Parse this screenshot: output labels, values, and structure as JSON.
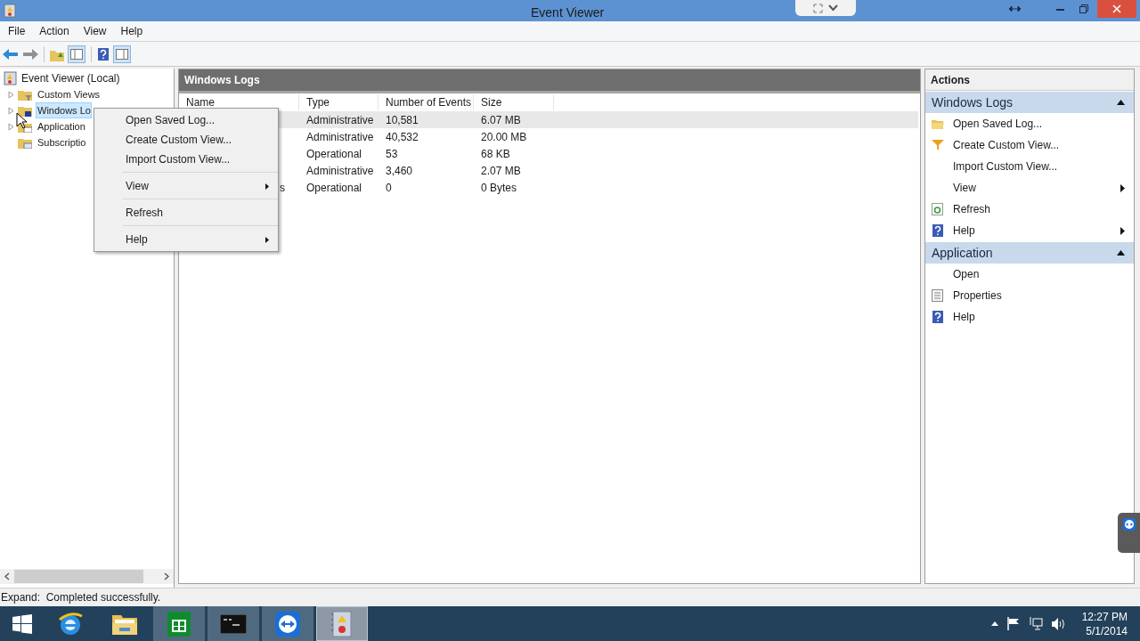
{
  "window": {
    "title": "Event Viewer"
  },
  "menu_bar": [
    "File",
    "Action",
    "View",
    "Help"
  ],
  "tree": {
    "label": "Event Viewer (Local)",
    "expanded": true,
    "children": [
      {
        "label": "Custom Views",
        "expanded": false,
        "selected": false,
        "kind": "filter-folder"
      },
      {
        "label": "Windows Lo",
        "expanded": false,
        "selected": true,
        "kind": "log-folder"
      },
      {
        "label": "Application",
        "expanded": false,
        "selected": false,
        "kind": "app-folder"
      },
      {
        "label": "Subscriptio",
        "selected": false,
        "kind": "sub-folder"
      }
    ]
  },
  "center": {
    "header": "Windows Logs",
    "columns": [
      "Name",
      "Type",
      "Number of Events",
      "Size"
    ],
    "rows": [
      {
        "type": "Administrative",
        "events": "10,581",
        "size": "6.07 MB",
        "selected": true
      },
      {
        "type": "Administrative",
        "events": "40,532",
        "size": "20.00 MB",
        "selected": false
      },
      {
        "type": "Operational",
        "events": "53",
        "size": "68 KB",
        "selected": false
      },
      {
        "type": "Administrative",
        "events": "3,460",
        "size": "2.07 MB",
        "selected": false
      },
      {
        "name": "s",
        "type": "Operational",
        "events": "0",
        "size": "0 Bytes",
        "selected": false
      }
    ]
  },
  "context_menu": [
    {
      "label": "Open Saved Log...",
      "submenu": false,
      "separator_after": false
    },
    {
      "label": "Create Custom View...",
      "submenu": false,
      "separator_after": false
    },
    {
      "label": "Import Custom View...",
      "submenu": false,
      "separator_after": true
    },
    {
      "label": "View",
      "submenu": true,
      "separator_after": true
    },
    {
      "label": "Refresh",
      "submenu": false,
      "separator_after": true
    },
    {
      "label": "Help",
      "submenu": true,
      "separator_after": false
    }
  ],
  "actions": {
    "title": "Actions",
    "sections": [
      {
        "title": "Windows Logs",
        "expanded": true,
        "items": [
          {
            "label": "Open Saved Log...",
            "kind": "folder",
            "submenu": false
          },
          {
            "label": "Create Custom View...",
            "kind": "filter",
            "submenu": false
          },
          {
            "label": "Import Custom View...",
            "kind": "plain",
            "submenu": false
          },
          {
            "label": "View",
            "kind": "plain",
            "submenu": true
          },
          {
            "label": "Refresh",
            "kind": "refresh",
            "submenu": false
          },
          {
            "label": "Help",
            "kind": "help",
            "submenu": true
          }
        ]
      },
      {
        "title": "Application",
        "expanded": true,
        "items": [
          {
            "label": "Open",
            "kind": "plain",
            "submenu": false
          },
          {
            "label": "Properties",
            "kind": "properties",
            "submenu": false
          },
          {
            "label": "Help",
            "kind": "help",
            "submenu": false
          }
        ]
      }
    ]
  },
  "status_bar": "Expand:  Completed successfully.",
  "taskbar": {
    "apps": [
      {
        "kind": "ie",
        "selected": false
      },
      {
        "kind": "explorer",
        "selected": false
      },
      {
        "kind": "store",
        "selected": false
      },
      {
        "kind": "cmd",
        "selected": false
      },
      {
        "kind": "teamviewer",
        "selected": false
      },
      {
        "kind": "eventviewer",
        "selected": true
      }
    ],
    "time": "12:27 PM",
    "date": "5/1/2014"
  }
}
